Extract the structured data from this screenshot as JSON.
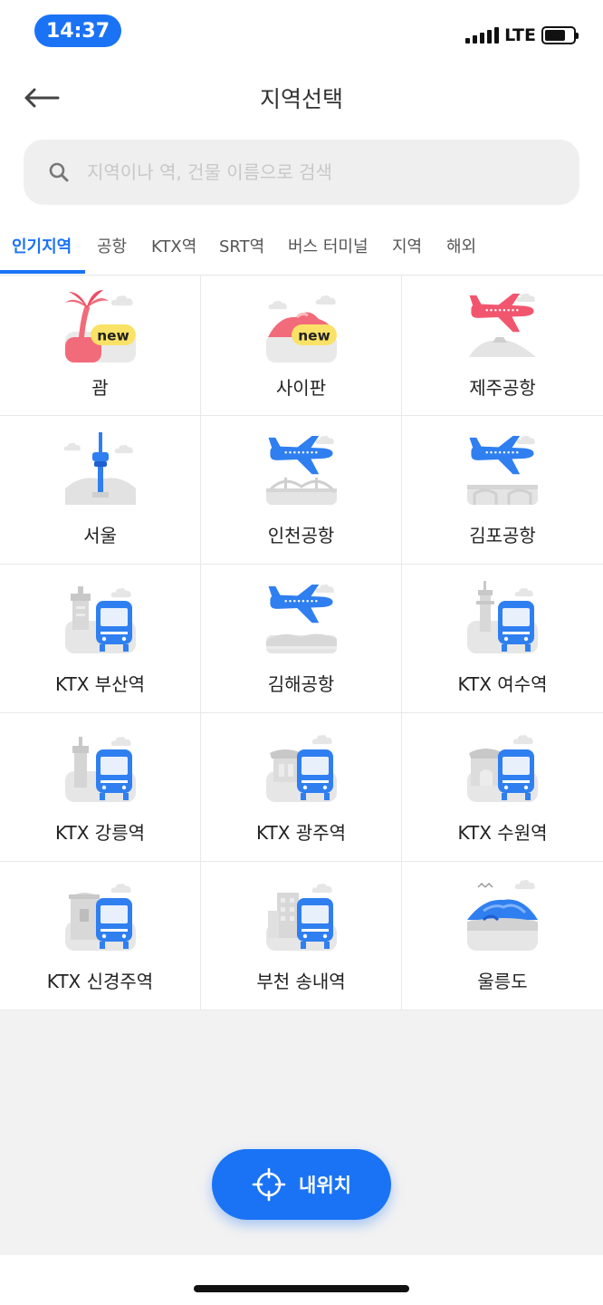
{
  "status_bar": {
    "time": "14:37",
    "network": "LTE",
    "battery_level": 0.72
  },
  "header": {
    "title": "지역선택",
    "back_icon": "arrow-left-icon"
  },
  "search": {
    "placeholder": "지역이나 역, 건물 이름으로 검색",
    "value": "",
    "icon": "search-icon"
  },
  "tabs": [
    {
      "label": "인기지역",
      "active": true
    },
    {
      "label": "공항",
      "active": false
    },
    {
      "label": "KTX역",
      "active": false
    },
    {
      "label": "SRT역",
      "active": false
    },
    {
      "label": "버스 터미널",
      "active": false
    },
    {
      "label": "지역",
      "active": false
    },
    {
      "label": "해외",
      "active": false
    }
  ],
  "destinations": [
    {
      "label": "괌",
      "icon": "palm-tree-icon",
      "badge": "new"
    },
    {
      "label": "사이판",
      "icon": "island-icon",
      "badge": "new"
    },
    {
      "label": "제주공항",
      "icon": "plane-red-icon"
    },
    {
      "label": "서울",
      "icon": "seoul-tower-icon"
    },
    {
      "label": "인천공항",
      "icon": "plane-bridge-icon"
    },
    {
      "label": "김포공항",
      "icon": "plane-bridge-icon"
    },
    {
      "label": "KTX 부산역",
      "icon": "train-lighthouse-icon"
    },
    {
      "label": "김해공항",
      "icon": "plane-mountain-icon"
    },
    {
      "label": "KTX 여수역",
      "icon": "train-tower-icon"
    },
    {
      "label": "KTX 강릉역",
      "icon": "train-lighthouse-icon"
    },
    {
      "label": "KTX 광주역",
      "icon": "train-hanok-icon"
    },
    {
      "label": "KTX 수원역",
      "icon": "train-gate-icon"
    },
    {
      "label": "KTX 신경주역",
      "icon": "train-pagoda-icon"
    },
    {
      "label": "부천 송내역",
      "icon": "train-building-icon"
    },
    {
      "label": "울릉도",
      "icon": "island-mountain-icon"
    }
  ],
  "location_button": {
    "label": "내위치",
    "icon": "crosshair-icon"
  },
  "colors": {
    "accent": "#1a73f5",
    "plane_red": "#f2566f",
    "plane_blue": "#2f7ff0"
  }
}
